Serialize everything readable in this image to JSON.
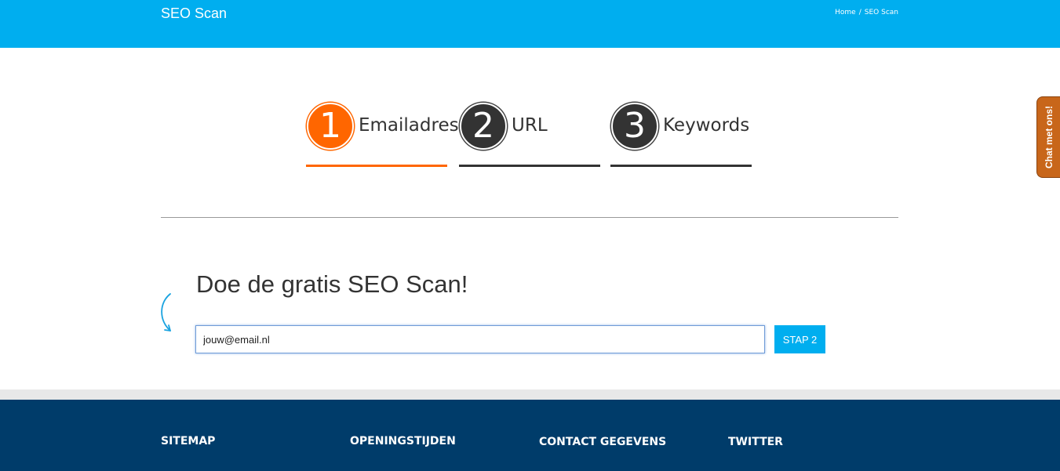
{
  "header": {
    "site_title": "SEO Scan",
    "breadcrumb": {
      "home": "Home",
      "separator": "/",
      "current": "SEO Scan"
    }
  },
  "steps": [
    {
      "number": "1",
      "label": "Emailadres",
      "active": true
    },
    {
      "number": "2",
      "label": "URL",
      "active": false
    },
    {
      "number": "3",
      "label": "Keywords",
      "active": false
    }
  ],
  "form": {
    "heading": "Doe de gratis SEO Scan!",
    "email_value": "jouw@email.nl",
    "submit_label": "STAP 2"
  },
  "chat": {
    "label": "Chat met ons!"
  },
  "footer": {
    "columns": [
      "SITEMAP",
      "OPENINGSTIJDEN",
      "CONTACT GEGEVENS",
      "TWITTER"
    ]
  },
  "colors": {
    "header_blue": "#00aeef",
    "step_active": "#ff6600",
    "step_inactive": "#333333",
    "footer_navy": "#003c6a",
    "chat_orange": "#c8661a"
  }
}
